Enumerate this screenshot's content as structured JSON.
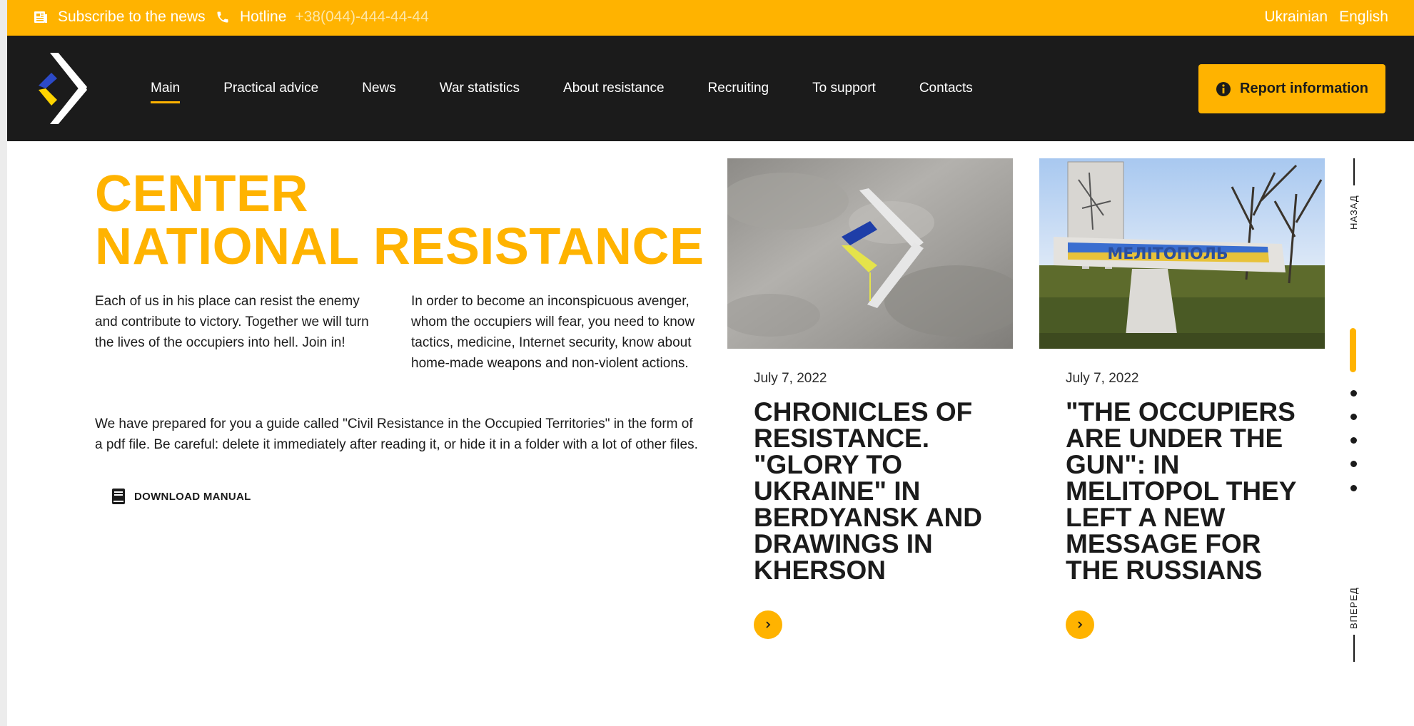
{
  "topbar": {
    "subscribe": "Subscribe to the news",
    "hotline_label": "Hotline",
    "hotline_number": "+38(044)-444-44-44",
    "languages": [
      "Ukrainian",
      "English"
    ]
  },
  "nav": {
    "items": [
      "Main",
      "Practical advice",
      "News",
      "War statistics",
      "About resistance",
      "Recruiting",
      "To support",
      "Contacts"
    ],
    "active": "Main",
    "report_button": "Report information"
  },
  "hero": {
    "title_line1": "CENTER",
    "title_line2": "NATIONAL RESISTANCE",
    "paragraph1": "Each of us in his place can resist the enemy and contribute to victory. Together we will turn the lives of the occupiers into hell. Join in!",
    "paragraph2": "In order to become an inconspicuous avenger, whom the occupiers will fear, you need to know tactics, medicine, Internet security, know about home-made weapons and non-violent actions.",
    "paragraph3": "We have prepared for you a guide called \"Civil Resistance in the Occupied Territories\" in the form of a pdf file. Be careful: delete it immediately after reading it, or hide it in a folder with a lot of other files.",
    "download_label": "DOWNLOAD MANUAL"
  },
  "news": [
    {
      "date": "July 7, 2022",
      "title": "CHRONICLES OF RESISTANCE. \"GLORY TO UKRAINE\" IN BERDYANSK AND DRAWINGS IN KHERSON"
    },
    {
      "date": "July 7, 2022",
      "title": "\"THE OCCUPIERS ARE UNDER THE GUN\": IN MELITOPOL THEY LEFT A NEW MESSAGE FOR THE RUSSIANS",
      "sign_text": "МЕЛІТОПОЛЬ"
    }
  ],
  "slider": {
    "back_label": "НАЗАД",
    "forward_label": "ВПЕРЕД"
  },
  "colors": {
    "accent": "#ffb300",
    "dark": "#1b1b1b",
    "white": "#ffffff"
  }
}
